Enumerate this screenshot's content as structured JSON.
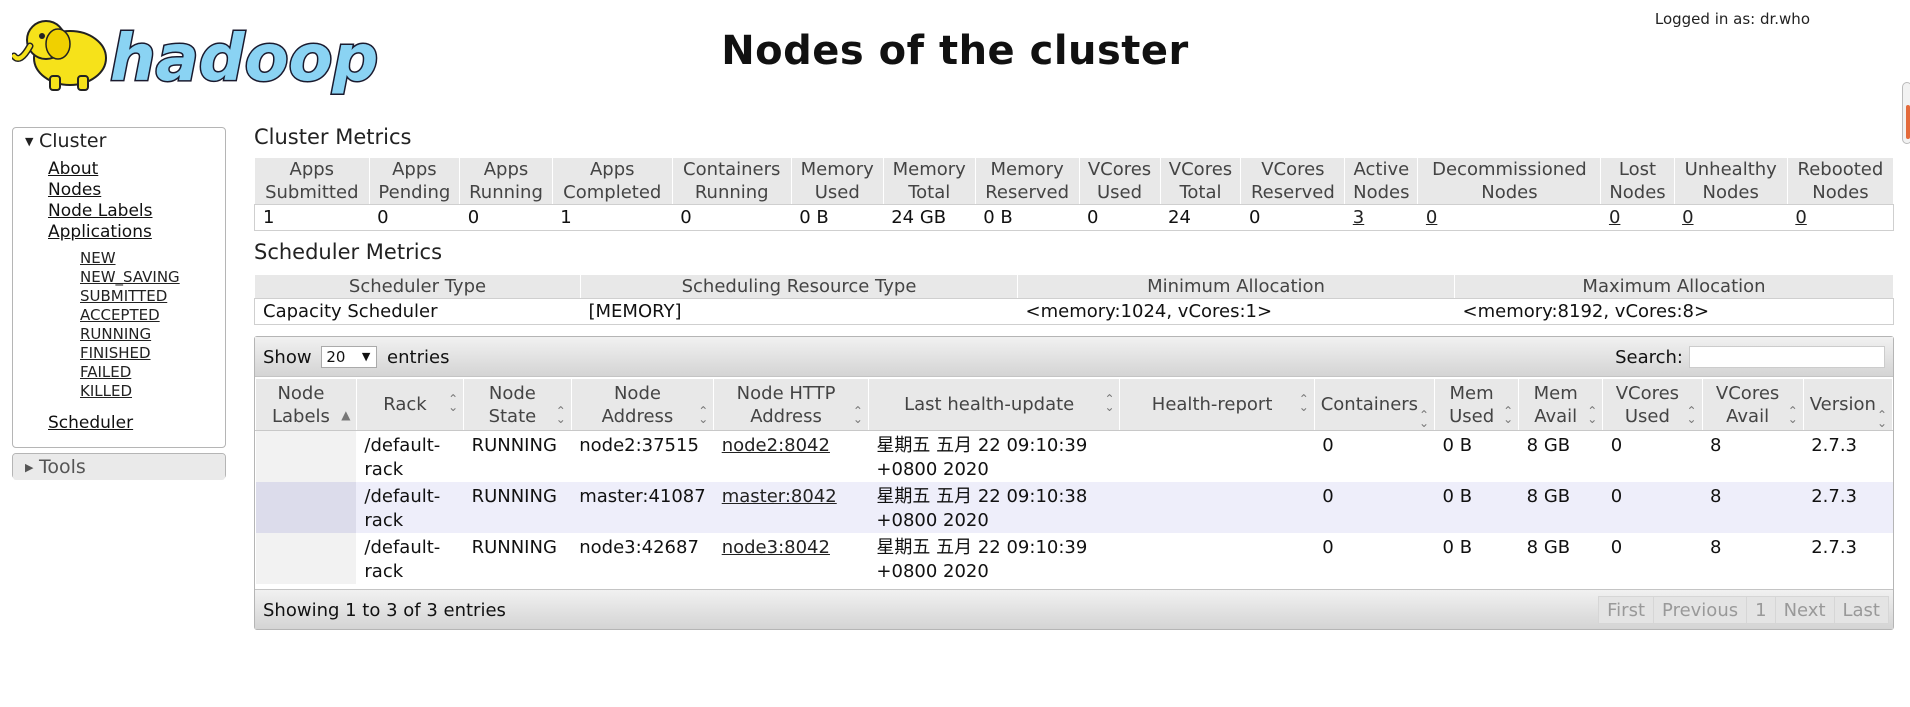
{
  "header": {
    "logo_text": "hadoop",
    "title": "Nodes of the cluster",
    "login_text": "Logged in as: dr.who"
  },
  "nav": {
    "cluster_label": "Cluster",
    "about": "About",
    "nodes": "Nodes",
    "node_labels": "Node Labels",
    "applications": "Applications",
    "app_states": [
      "NEW",
      "NEW_SAVING",
      "SUBMITTED",
      "ACCEPTED",
      "RUNNING",
      "FINISHED",
      "FAILED",
      "KILLED"
    ],
    "scheduler": "Scheduler",
    "tools_label": "Tools"
  },
  "cluster_metrics": {
    "title": "Cluster Metrics",
    "headers": [
      [
        "Apps",
        "Submitted"
      ],
      [
        "Apps",
        "Pending"
      ],
      [
        "Apps",
        "Running"
      ],
      [
        "Apps",
        "Completed"
      ],
      [
        "Containers",
        "Running"
      ],
      [
        "Memory",
        "Used"
      ],
      [
        "Memory",
        "Total"
      ],
      [
        "Memory",
        "Reserved"
      ],
      [
        "VCores",
        "Used"
      ],
      [
        "VCores",
        "Total"
      ],
      [
        "VCores",
        "Reserved"
      ],
      [
        "Active",
        "Nodes"
      ],
      [
        "Decommissioned",
        "Nodes"
      ],
      [
        "Lost",
        "Nodes"
      ],
      [
        "Unhealthy",
        "Nodes"
      ],
      [
        "Rebooted",
        "Nodes"
      ]
    ],
    "values": [
      "1",
      "0",
      "0",
      "1",
      "0",
      "0 B",
      "24 GB",
      "0 B",
      "0",
      "24",
      "0",
      "3",
      "0",
      "0",
      "0",
      "0"
    ]
  },
  "scheduler_metrics": {
    "title": "Scheduler Metrics",
    "headers": [
      "Scheduler Type",
      "Scheduling Resource Type",
      "Minimum Allocation",
      "Maximum Allocation"
    ],
    "values": [
      "Capacity Scheduler",
      "[MEMORY]",
      "<memory:1024, vCores:1>",
      "<memory:8192, vCores:8>"
    ]
  },
  "nodes_table": {
    "show_label": "Show",
    "entries_label": "entries",
    "page_length": "20",
    "search_label": "Search:",
    "headers": [
      [
        "Node",
        "Labels"
      ],
      [
        "Rack"
      ],
      [
        "Node",
        "State"
      ],
      [
        "Node",
        "Address"
      ],
      [
        "Node HTTP",
        "Address"
      ],
      [
        "Last health-update"
      ],
      [
        "Health-report"
      ],
      [
        "Containers"
      ],
      [
        "Mem",
        "Used"
      ],
      [
        "Mem",
        "Avail"
      ],
      [
        "VCores",
        "Used"
      ],
      [
        "VCores",
        "Avail"
      ],
      [
        "Version"
      ]
    ],
    "rows": [
      {
        "labels": "",
        "rack": [
          "/default-",
          "rack"
        ],
        "state": "RUNNING",
        "address": "node2:37515",
        "http": "node2:8042",
        "health_update": [
          "星期五 五月 22 09:10:39",
          "+0800 2020"
        ],
        "health_report": "",
        "containers": "0",
        "mem_used": "0 B",
        "mem_avail": "8 GB",
        "vcores_used": "0",
        "vcores_avail": "8",
        "version": "2.7.3"
      },
      {
        "labels": "",
        "rack": [
          "/default-",
          "rack"
        ],
        "state": "RUNNING",
        "address": "master:41087",
        "http": "master:8042",
        "health_update": [
          "星期五 五月 22 09:10:38",
          "+0800 2020"
        ],
        "health_report": "",
        "containers": "0",
        "mem_used": "0 B",
        "mem_avail": "8 GB",
        "vcores_used": "0",
        "vcores_avail": "8",
        "version": "2.7.3"
      },
      {
        "labels": "",
        "rack": [
          "/default-",
          "rack"
        ],
        "state": "RUNNING",
        "address": "node3:42687",
        "http": "node3:8042",
        "health_update": [
          "星期五 五月 22 09:10:39",
          "+0800 2020"
        ],
        "health_report": "",
        "containers": "0",
        "mem_used": "0 B",
        "mem_avail": "8 GB",
        "vcores_used": "0",
        "vcores_avail": "8",
        "version": "2.7.3"
      }
    ],
    "info": "Showing 1 to 3 of 3 entries",
    "pager": [
      "First",
      "Previous",
      "1",
      "Next",
      "Last"
    ]
  }
}
